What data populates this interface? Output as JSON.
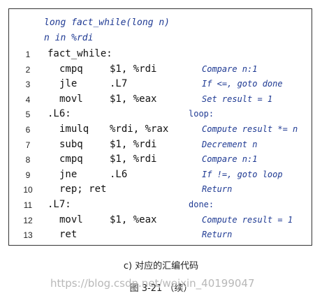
{
  "header": {
    "signature": "long fact_while(long n)",
    "param": "n in %rdi"
  },
  "lines": [
    {
      "num": "1",
      "label": "fact_while:",
      "instr": "",
      "operand": "",
      "comment": ""
    },
    {
      "num": "2",
      "label": "",
      "instr": "cmpq",
      "operand": "$1, %rdi",
      "comment": "Compare n:1"
    },
    {
      "num": "3",
      "label": "",
      "instr": "jle",
      "operand": ".L7",
      "comment": "If <=, goto done"
    },
    {
      "num": "4",
      "label": "",
      "instr": "movl",
      "operand": "$1, %eax",
      "comment": "Set result = 1"
    },
    {
      "num": "5",
      "label": ".L6:",
      "instr": "",
      "operand": "",
      "comment": "loop:"
    },
    {
      "num": "6",
      "label": "",
      "instr": "imulq",
      "operand": "%rdi, %rax",
      "comment": "Compute result *= n"
    },
    {
      "num": "7",
      "label": "",
      "instr": "subq",
      "operand": "$1, %rdi",
      "comment": "Decrement n"
    },
    {
      "num": "8",
      "label": "",
      "instr": "cmpq",
      "operand": "$1, %rdi",
      "comment": "Compare n:1"
    },
    {
      "num": "9",
      "label": "",
      "instr": "jne",
      "operand": ".L6",
      "comment": "If !=, goto loop"
    },
    {
      "num": "10",
      "label": "",
      "instr": "rep; ret",
      "operand": "",
      "comment": "Return"
    },
    {
      "num": "11",
      "label": ".L7:",
      "instr": "",
      "operand": "",
      "comment": "done:"
    },
    {
      "num": "12",
      "label": "",
      "instr": "movl",
      "operand": "$1, %eax",
      "comment": "Compute result = 1"
    },
    {
      "num": "13",
      "label": "",
      "instr": "ret",
      "operand": "",
      "comment": "Return"
    }
  ],
  "caption": "c) 对应的汇编代码",
  "figure_caption": "图 3-21 （续）",
  "watermark": "https://blog.csdn.net/weixin_40199047"
}
